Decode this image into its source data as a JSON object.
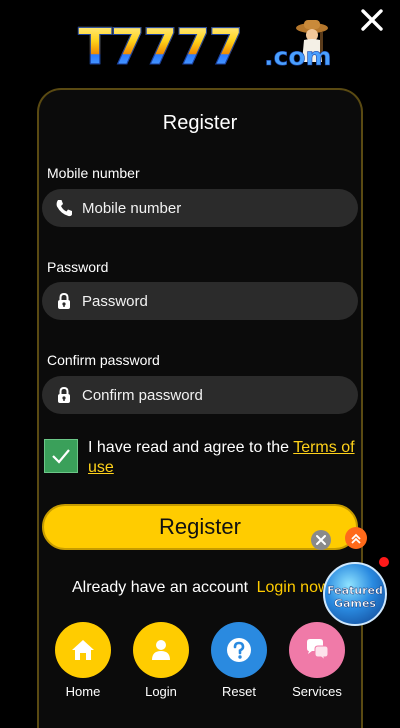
{
  "brand": {
    "logo_main": "T7777",
    "logo_suffix": ".com"
  },
  "form": {
    "title": "Register",
    "mobile": {
      "label": "Mobile number",
      "placeholder": "Mobile number",
      "value": ""
    },
    "password": {
      "label": "Password",
      "placeholder": "Password",
      "value": ""
    },
    "confirm": {
      "label": "Confirm password",
      "placeholder": "Confirm password",
      "value": ""
    },
    "agree_text": "I have read and agree to the",
    "terms_link": "Terms of use",
    "agree_checked": true,
    "register_button": "Register",
    "account_prompt": "Already have an account",
    "login_link": "Login now"
  },
  "featured": {
    "line1": "Featured",
    "line2": "Games"
  },
  "bottom_nav": [
    {
      "label": "Home",
      "icon": "home-icon",
      "color": "#ffcc00"
    },
    {
      "label": "Login",
      "icon": "user-icon",
      "color": "#ffcc00"
    },
    {
      "label": "Reset",
      "icon": "question-icon",
      "color": "#2a8ae0"
    },
    {
      "label": "Services",
      "icon": "chat-icon",
      "color": "#f07aa8"
    }
  ],
  "colors": {
    "accent": "#ffcc00",
    "background": "#000000",
    "field": "#2b2b2b",
    "checkbox": "#3aa05a"
  }
}
